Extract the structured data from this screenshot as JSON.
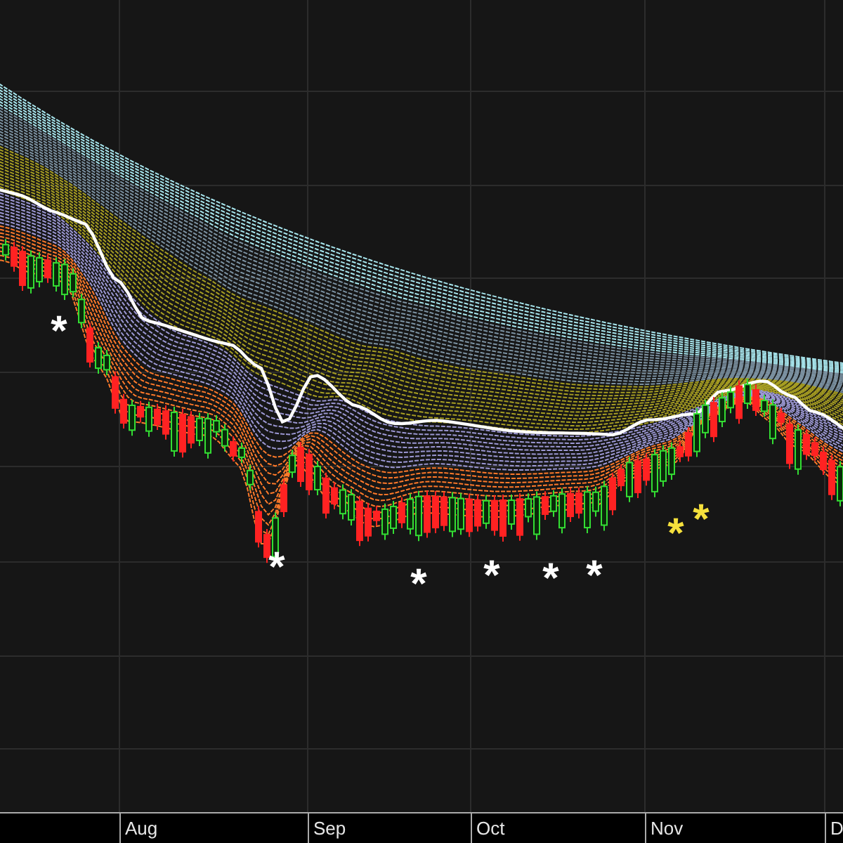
{
  "markers": [
    {
      "text": "*",
      "color": "#ffffff"
    },
    {
      "text": "*",
      "color": "#ffffff"
    },
    {
      "text": "*",
      "color": "#ffffff"
    },
    {
      "text": "*",
      "color": "#ffffff"
    },
    {
      "text": "*",
      "color": "#ffffff"
    },
    {
      "text": "*",
      "color": "#ffffff"
    },
    {
      "text": "*",
      "color": "#f5e03c"
    },
    {
      "text": "*",
      "color": "#f5e03c"
    }
  ],
  "x_axis": {
    "labels": [
      "Aug",
      "Sep",
      "Oct",
      "Nov",
      "D"
    ]
  }
}
